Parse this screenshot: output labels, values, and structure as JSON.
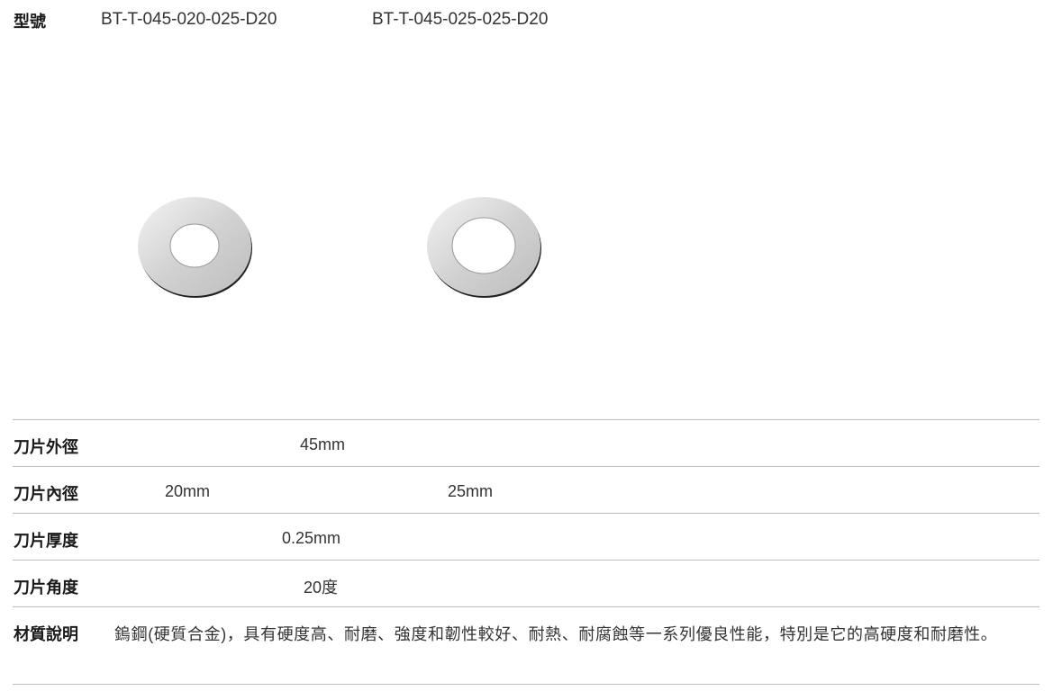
{
  "header": {
    "label": "型號",
    "models": [
      "BT-T-045-020-025-D20",
      "BT-T-045-025-025-D20"
    ]
  },
  "products": [
    {
      "name": "blade-20mm",
      "image": "washer-blade-image"
    },
    {
      "name": "blade-25mm",
      "image": "washer-blade-image"
    }
  ],
  "specs": {
    "outer_diameter": {
      "label": "刀片外徑",
      "value": "45mm"
    },
    "inner_diameter": {
      "label": "刀片內徑",
      "values": [
        "20mm",
        "25mm"
      ]
    },
    "thickness": {
      "label": "刀片厚度",
      "value": "0.25mm"
    },
    "angle": {
      "label": "刀片角度",
      "value": "20度"
    },
    "material": {
      "label": "材質說明",
      "text": "鎢鋼(硬質合金)，具有硬度高、耐磨、強度和韌性較好、耐熱、耐腐蝕等一系列優良性能，特別是它的高硬度和耐磨性。"
    }
  },
  "colors": {
    "rule": "#bdbdbd",
    "label_text": "#1a1a1a",
    "value_text": "#333333"
  }
}
